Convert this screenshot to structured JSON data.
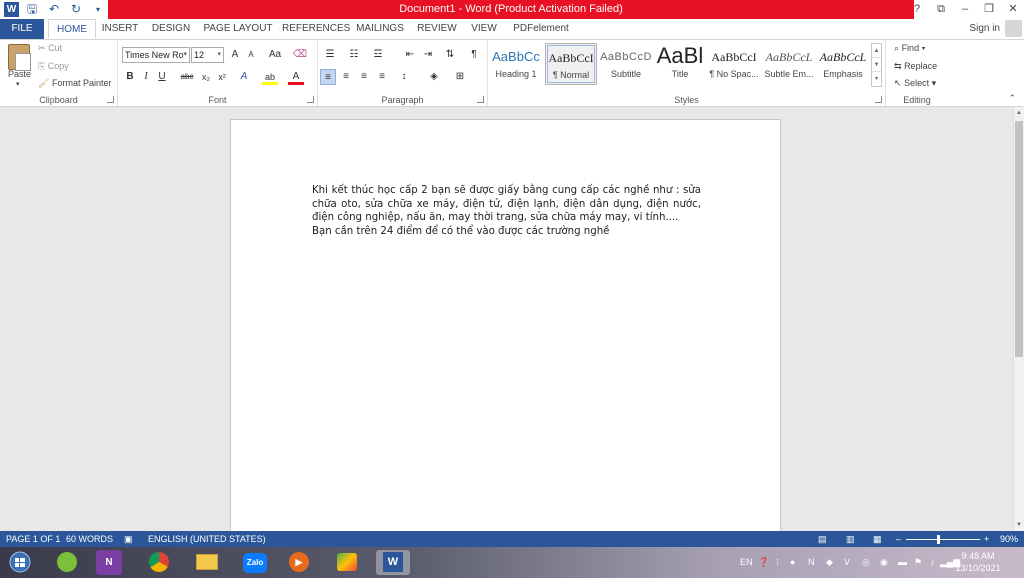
{
  "titlebar": {
    "title": "Document1 - Word (Product Activation Failed)",
    "controls": {
      "help": "?",
      "ribbon_options": "⧉",
      "minimize": "–",
      "restore": "❐",
      "close": "✕"
    }
  },
  "tabs": [
    {
      "label": "FILE"
    },
    {
      "label": "HOME"
    },
    {
      "label": "INSERT"
    },
    {
      "label": "DESIGN"
    },
    {
      "label": "PAGE LAYOUT"
    },
    {
      "label": "REFERENCES"
    },
    {
      "label": "MAILINGS"
    },
    {
      "label": "REVIEW"
    },
    {
      "label": "VIEW"
    },
    {
      "label": "PDFelement"
    }
  ],
  "signin": "Sign in",
  "clipboard": {
    "paste": "Paste",
    "cut": "Cut",
    "copy": "Copy",
    "format_painter": "Format Painter",
    "label": "Clipboard"
  },
  "font": {
    "family": "Times New Ro",
    "size": "12",
    "label": "Font",
    "grow": "A",
    "shrink": "A",
    "case": "Aa",
    "bold": "B",
    "italic": "I",
    "underline": "U",
    "strike": "abc",
    "subscript": "x₂",
    "superscript": "x²",
    "text_effects": "A",
    "highlight": "ab",
    "font_color": "A",
    "font_color_value": "#e81123",
    "highlight_color_value": "#ffff00"
  },
  "paragraph": {
    "label": "Paragraph",
    "show_marks": "¶"
  },
  "styles": {
    "label": "Styles",
    "items": [
      {
        "sample": "AaBbCc",
        "name": "Heading 1"
      },
      {
        "sample": "AaBbCcI",
        "name": "¶ Normal"
      },
      {
        "sample": "AaBbCcD",
        "name": "Subtitle"
      },
      {
        "sample": "AaBl",
        "name": "Title"
      },
      {
        "sample": "AaBbCcI",
        "name": "¶ No Spac..."
      },
      {
        "sample": "AaBbCcL",
        "name": "Subtle Em..."
      },
      {
        "sample": "AaBbCcL",
        "name": "Emphasis"
      }
    ]
  },
  "editing": {
    "label": "Editing",
    "find": "Find",
    "replace": "Replace",
    "select": "Select"
  },
  "document": {
    "paragraph1": "Khi kết thúc học cấp 2 bạn sẽ được giấy bằng cung cấp các nghề như : sửa chữa oto, sửa chữa xe máy, điện tử, điện lạnh, điện dân dụng, điện nước, điện công nghiệp, nấu ăn, may thời trang, sửa chữa máy may, vi tính....",
    "paragraph2": "Bạn cần trên 24 điểm để có thể vào được các trường nghề"
  },
  "statusbar": {
    "page": "PAGE 1 OF 1",
    "words": "60 WORDS",
    "language": "ENGLISH (UNITED STATES)",
    "zoom": "90%",
    "zoom_minus": "–",
    "zoom_plus": "+"
  },
  "taskbar": {
    "apps": [
      {
        "name": "start",
        "label": ""
      },
      {
        "name": "ccleaner",
        "label": ""
      },
      {
        "name": "onenote",
        "label": "N"
      },
      {
        "name": "chrome",
        "label": ""
      },
      {
        "name": "file-explorer",
        "label": ""
      },
      {
        "name": "zalo",
        "label": "Zalo"
      },
      {
        "name": "media-player",
        "label": ""
      },
      {
        "name": "app-folder",
        "label": ""
      },
      {
        "name": "word",
        "label": "W"
      }
    ],
    "lang": "EN",
    "time": "9:48 AM",
    "date": "13/10/2021"
  }
}
